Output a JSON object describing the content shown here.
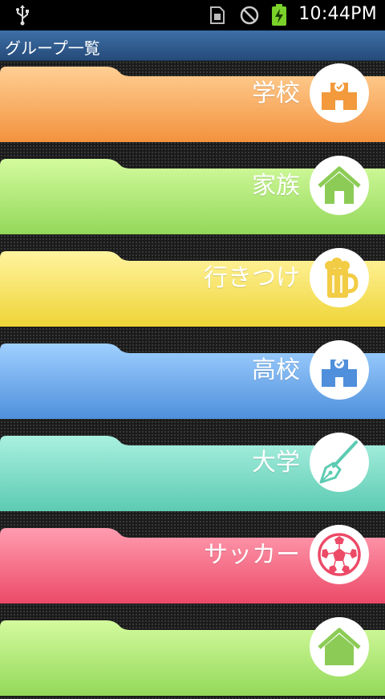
{
  "status_bar": {
    "time": "10:44PM",
    "icons": [
      "usb-icon",
      "sim-card-icon",
      "no-signal-icon",
      "battery-charging-icon"
    ]
  },
  "header": {
    "title": "グループ一覧"
  },
  "groups": [
    {
      "label": "学校",
      "icon": "school-icon",
      "color": "#f4a14e"
    },
    {
      "label": "家族",
      "icon": "house-icon",
      "color": "#a0e06a"
    },
    {
      "label": "行きつけ",
      "icon": "beer-icon",
      "color": "#f4dd42"
    },
    {
      "label": "高校",
      "icon": "school-icon",
      "color": "#5a9ae0"
    },
    {
      "label": "大学",
      "icon": "pen-nib-icon",
      "color": "#6fd6c0"
    },
    {
      "label": "サッカー",
      "icon": "soccer-ball-icon",
      "color": "#f06078"
    },
    {
      "label": "",
      "icon": "house-icon",
      "color": "#a0e06a"
    }
  ]
}
